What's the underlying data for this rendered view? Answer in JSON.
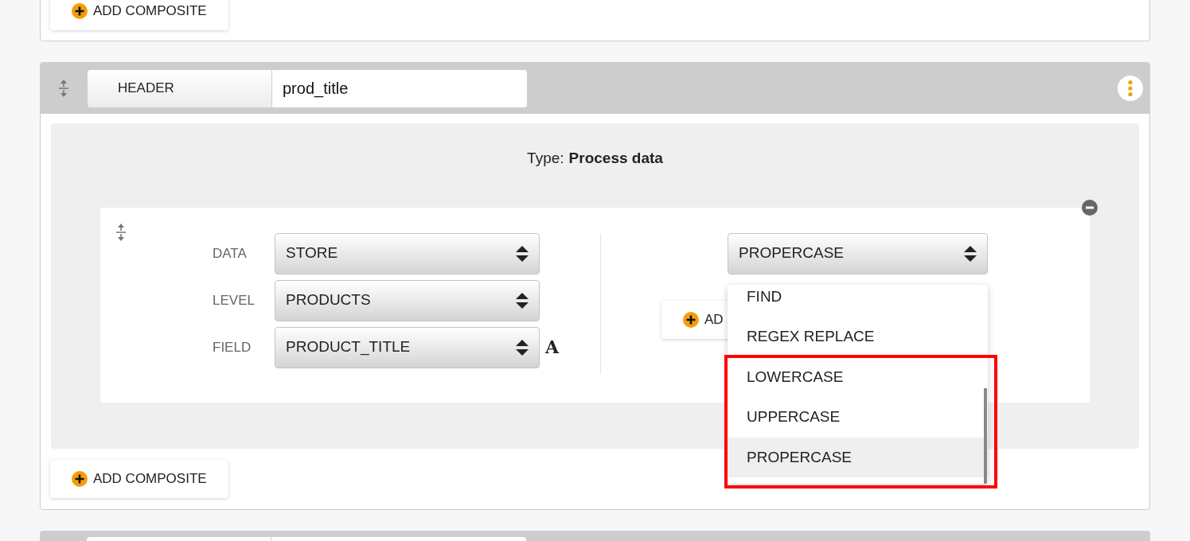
{
  "top_card": {
    "add_button": "ADD COMPOSITE"
  },
  "composite": {
    "header_label": "HEADER",
    "name_value": "prod_title",
    "type_label": "Type:",
    "type_value": "Process data",
    "fields": [
      {
        "label": "DATA",
        "value": "STORE"
      },
      {
        "label": "LEVEL",
        "value": "PRODUCTS"
      },
      {
        "label": "FIELD",
        "value": "PRODUCT_TITLE",
        "badge": "A"
      }
    ],
    "operation": {
      "value": "PROPERCASE",
      "add_button": "AD",
      "options": [
        {
          "label": "FIND",
          "selected": false
        },
        {
          "label": "REGEX REPLACE",
          "selected": false
        },
        {
          "label": "LOWERCASE",
          "selected": false
        },
        {
          "label": "UPPERCASE",
          "selected": false
        },
        {
          "label": "PROPERCASE",
          "selected": true
        }
      ]
    },
    "add_button": "ADD COMPOSITE"
  }
}
